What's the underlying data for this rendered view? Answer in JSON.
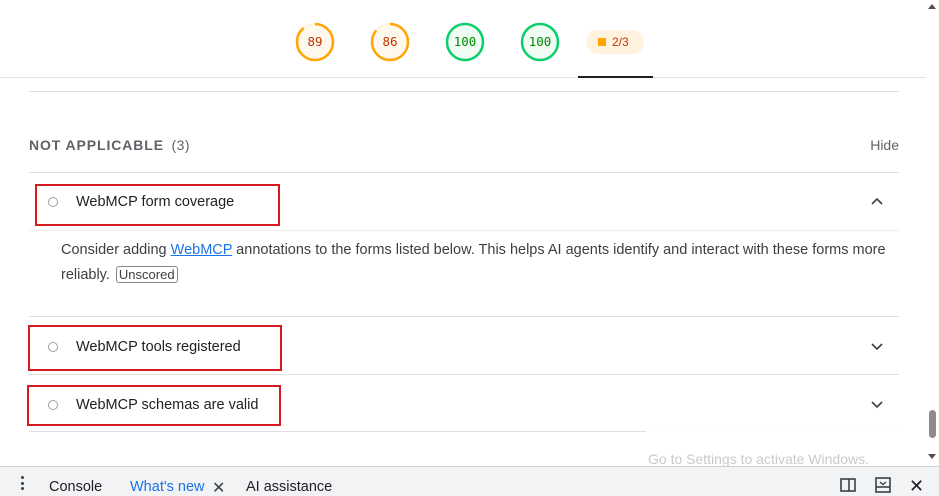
{
  "scores": [
    {
      "value": "89",
      "score": 0.89,
      "color": "#ffa400",
      "text_color": "#c33300"
    },
    {
      "value": "86",
      "score": 0.86,
      "color": "#ffa400",
      "text_color": "#c33300"
    },
    {
      "value": "100",
      "score": 1.0,
      "color": "#0cce6b",
      "text_color": "#008800"
    },
    {
      "value": "100",
      "score": 1.0,
      "color": "#0cce6b",
      "text_color": "#008800"
    }
  ],
  "pwa_badge": {
    "label": "2/3",
    "color": "#ffa400"
  },
  "group": {
    "title": "NOT APPLICABLE",
    "count": "(3)",
    "hide_label": "Hide"
  },
  "audits": [
    {
      "title": "WebMCP form coverage",
      "expanded": true,
      "description_before": "Consider adding ",
      "description_link": "WebMCP",
      "description_after": " annotations to the forms listed below. This helps AI agents identify and interact with these forms more reliably.",
      "badge": "Unscored"
    },
    {
      "title": "WebMCP tools registered",
      "expanded": false
    },
    {
      "title": "WebMCP schemas are valid",
      "expanded": false
    }
  ],
  "watermark": "Go to Settings to activate Windows.",
  "drawer": {
    "tabs": [
      "Console",
      "What's new",
      "AI assistance"
    ],
    "active_tab": "What's new",
    "close_glyph": "✕",
    "right_close_glyph": "✕"
  },
  "colors": {
    "accent": "#1a73e8",
    "highlight": "#d71920",
    "pass": "#0cce6b",
    "average": "#ffa400"
  }
}
